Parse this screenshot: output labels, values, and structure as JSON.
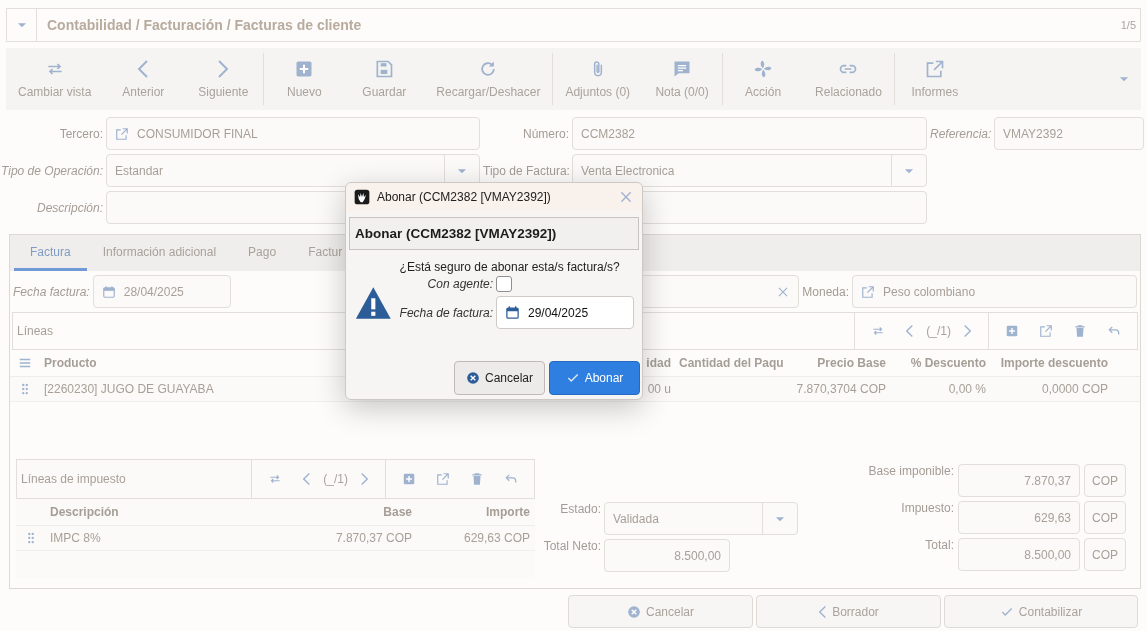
{
  "header": {
    "title": "Contabilidad / Facturación / Facturas de cliente",
    "counter": "1/5"
  },
  "toolbar": {
    "groups": [
      {
        "buttons": [
          {
            "label": "Cambiar vista"
          },
          {
            "label": "Anterior"
          },
          {
            "label": "Siguiente"
          }
        ]
      },
      {
        "buttons": [
          {
            "label": "Nuevo"
          },
          {
            "label": "Guardar"
          },
          {
            "label": "Recargar/Deshacer"
          }
        ]
      },
      {
        "buttons": [
          {
            "label": "Adjuntos (0)"
          },
          {
            "label": "Nota (0/0)"
          }
        ]
      },
      {
        "buttons": [
          {
            "label": "Acción"
          },
          {
            "label": "Relacionado"
          }
        ]
      },
      {
        "buttons": [
          {
            "label": "Informes"
          }
        ]
      }
    ]
  },
  "form": {
    "tercero": {
      "label": "Tercero:",
      "value": "CONSUMIDOR FINAL"
    },
    "numero": {
      "label": "Número:",
      "value": "CCM2382"
    },
    "referencia": {
      "label": "Referencia:",
      "value": "VMAY2392"
    },
    "tipo_operacion": {
      "label": "Tipo de Operación:",
      "value": "Estandar"
    },
    "tipo_factura": {
      "label": "Tipo de Factura:",
      "value": "Venta Electronica"
    },
    "descripcion": {
      "label": "Descripción:"
    }
  },
  "tabs": [
    {
      "label": "Factura",
      "selected": true
    },
    {
      "label": "Información adicional",
      "selected": false
    },
    {
      "label": "Pago",
      "selected": false
    },
    {
      "label": "Factur",
      "selected": false
    }
  ],
  "fecha_factura": {
    "label": "Fecha factura:",
    "value": "28/04/2025"
  },
  "moneda": {
    "label": "Moneda:",
    "value": "Peso colombiano"
  },
  "lines": {
    "title": "Líneas",
    "pager": "(_/1)",
    "columns": [
      "Producto",
      "idad",
      "Cantidad del Paqu",
      "Precio Base",
      "% Descuento",
      "Importe descuento"
    ],
    "rows": [
      {
        "cells": [
          "[2260230] JUGO DE GUAYABA",
          "00 u",
          "",
          "7.870,3704 COP",
          "0,00 %",
          "0,0000 COP"
        ]
      }
    ]
  },
  "tax_lines": {
    "title": "Líneas de impuesto",
    "pager": "(_/1)",
    "columns": [
      "Descripción",
      "Base",
      "Importe"
    ],
    "rows": [
      {
        "cells": [
          "IMPC 8%",
          "7.870,37 COP",
          "629,63 COP"
        ]
      }
    ]
  },
  "estado": {
    "label": "Estado:",
    "value": "Validada"
  },
  "total_neto": {
    "label": "Total Neto:",
    "value": "8.500,00"
  },
  "totals": [
    {
      "label": "Base imponible:",
      "value": "7.870,37",
      "unit": "COP"
    },
    {
      "label": "Impuesto:",
      "value": "629,63",
      "unit": "COP"
    },
    {
      "label": "Total:",
      "value": "8.500,00",
      "unit": "COP"
    }
  ],
  "footer_buttons": [
    {
      "label": "Cancelar"
    },
    {
      "label": "Borrador"
    },
    {
      "label": "Contabilizar"
    }
  ],
  "dialog": {
    "title": "Abonar (CCM2382 [VMAY2392])",
    "heading": "Abonar (CCM2382 [VMAY2392])",
    "question": "¿Está seguro de abonar esta/s factura/s?",
    "agent": {
      "label": "Con agente:",
      "checked": false
    },
    "date": {
      "label": "Fecha de factura:",
      "value": "29/04/2025"
    },
    "buttons": [
      {
        "label": "Cancelar",
        "kind": "cancel"
      },
      {
        "label": "Abonar",
        "kind": "primary"
      }
    ]
  }
}
